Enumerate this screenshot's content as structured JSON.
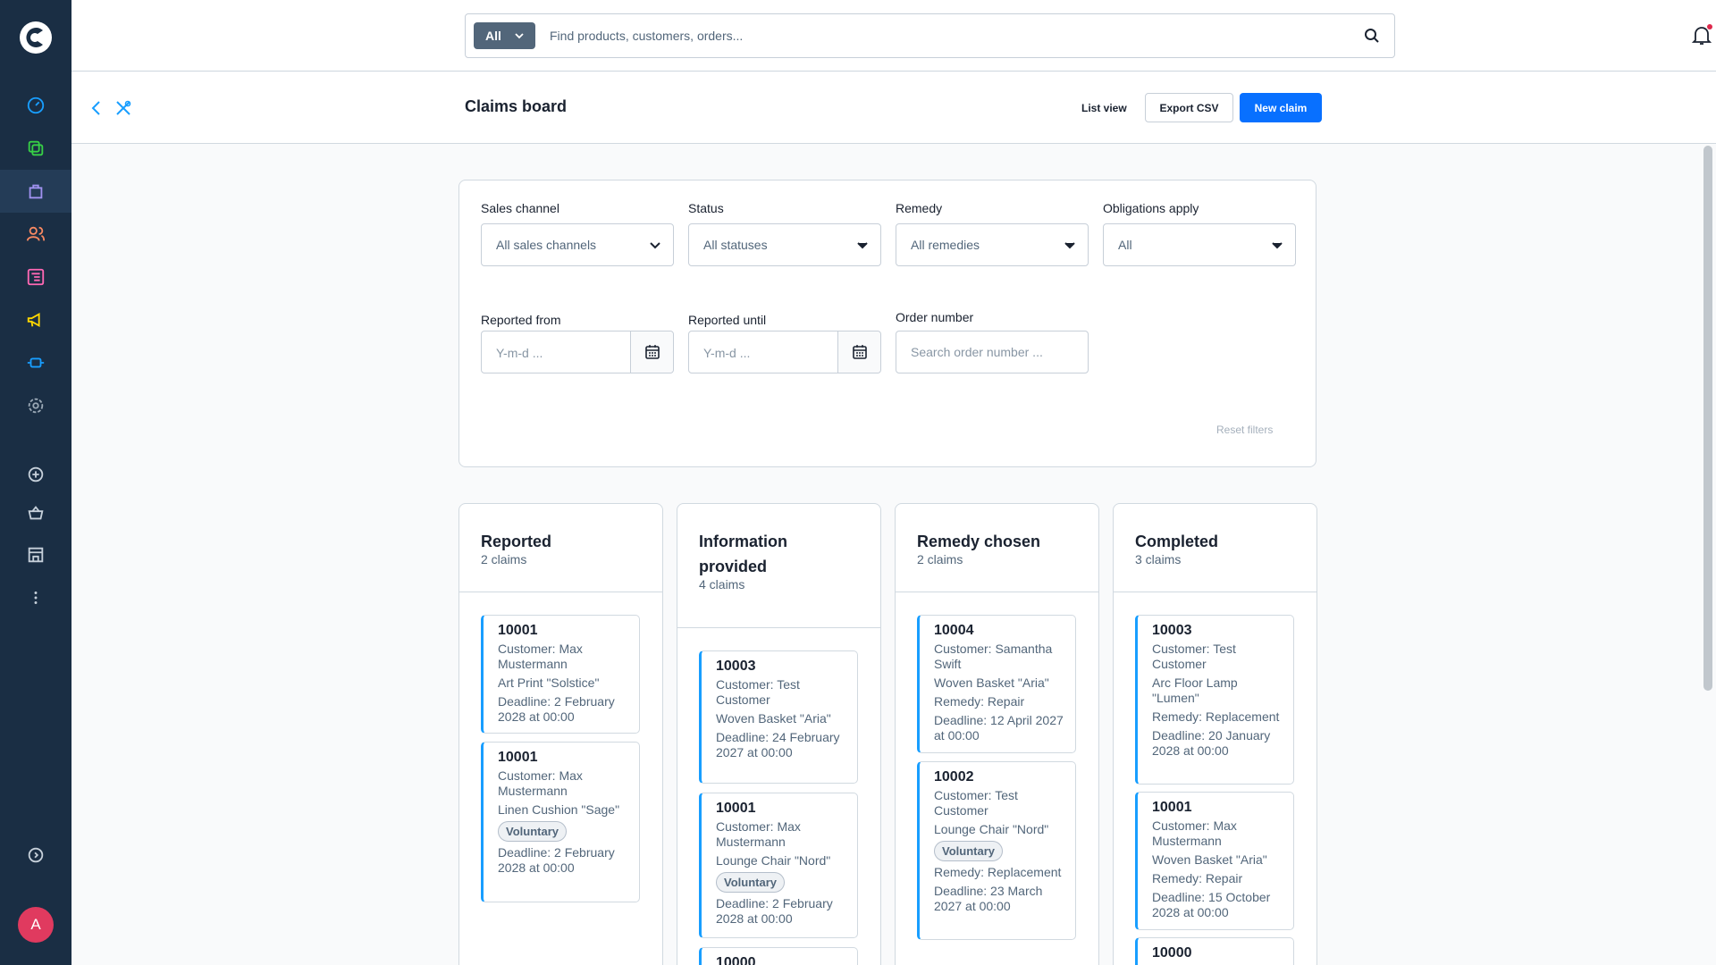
{
  "colors": {
    "sidebar": "#1a2e44",
    "primary": "#0870ff",
    "accent": "#189eff",
    "avatar": "#e03a5f"
  },
  "sidebar": {
    "items": [
      {
        "icon": "dashboard-icon"
      },
      {
        "icon": "catalogues-icon"
      },
      {
        "icon": "orders-icon"
      },
      {
        "icon": "customers-icon"
      },
      {
        "icon": "content-icon"
      },
      {
        "icon": "marketing-icon"
      },
      {
        "icon": "extensions-icon"
      },
      {
        "icon": "settings-icon"
      },
      {
        "icon": "add-circle-icon"
      },
      {
        "icon": "basket-icon"
      },
      {
        "icon": "store-icon"
      },
      {
        "icon": "more-icon"
      },
      {
        "icon": "collapse-icon"
      }
    ],
    "avatar": "A"
  },
  "search": {
    "scope": "All",
    "placeholder": "Find products, customers, orders..."
  },
  "header": {
    "title": "Claims board",
    "list_view": "List view",
    "export_csv": "Export CSV",
    "new_claim": "New claim"
  },
  "filters": {
    "sales_channel": {
      "label": "Sales channel",
      "value": "All sales channels"
    },
    "status": {
      "label": "Status",
      "value": "All statuses"
    },
    "remedy": {
      "label": "Remedy",
      "value": "All remedies"
    },
    "obligations": {
      "label": "Obligations apply",
      "value": "All"
    },
    "reported_from": {
      "label": "Reported from",
      "placeholder": "Y-m-d ..."
    },
    "reported_until": {
      "label": "Reported until",
      "placeholder": "Y-m-d ..."
    },
    "order_number": {
      "label": "Order number",
      "placeholder": "Search order number ..."
    },
    "reset": "Reset filters"
  },
  "columns": [
    {
      "title": "Reported",
      "count": "2 claims",
      "cards": [
        {
          "number": "10001",
          "lines": [
            "Customer: Max Mustermann",
            "Art Print \"Solstice\"",
            "Deadline: 2 February 2028 at 00:00"
          ]
        },
        {
          "number": "10001",
          "lines": [
            "Customer: Max Mustermann",
            "Linen Cushion \"Sage\""
          ],
          "badge": "Voluntary",
          "after": [
            "Deadline: 2 February 2028 at 00:00"
          ]
        }
      ]
    },
    {
      "title": "Information provided",
      "count": "4 claims",
      "cards": [
        {
          "number": "10003",
          "lines": [
            "Customer: Test Customer",
            "Woven Basket \"Aria\"",
            "Deadline: 24 February 2027 at 00:00"
          ]
        },
        {
          "number": "10001",
          "lines": [
            "Customer: Max Mustermann",
            "Lounge Chair \"Nord\""
          ],
          "badge": "Voluntary",
          "after": [
            "Deadline: 2 February 2028 at 00:00"
          ]
        },
        {
          "number": "10000",
          "lines": []
        }
      ]
    },
    {
      "title": "Remedy chosen",
      "count": "2 claims",
      "cards": [
        {
          "number": "10004",
          "lines": [
            "Customer: Samantha Swift",
            "Woven Basket \"Aria\"",
            "Remedy: Repair",
            "Deadline: 12 April 2027 at 00:00"
          ]
        },
        {
          "number": "10002",
          "lines": [
            "Customer: Test Customer",
            "Lounge Chair \"Nord\""
          ],
          "badge": "Voluntary",
          "after": [
            "Remedy: Replacement",
            "Deadline: 23 March 2027 at 00:00"
          ]
        }
      ]
    },
    {
      "title": "Completed",
      "count": "3 claims",
      "cards": [
        {
          "number": "10003",
          "lines": [
            "Customer: Test Customer",
            "Arc Floor Lamp \"Lumen\"",
            "Remedy: Replacement",
            "Deadline: 20 January 2028 at 00:00"
          ]
        },
        {
          "number": "10001",
          "lines": [
            "Customer: Max Mustermann",
            "Woven Basket \"Aria\"",
            "Remedy: Repair",
            "Deadline: 15 October 2028 at 00:00"
          ]
        },
        {
          "number": "10000",
          "lines": []
        }
      ]
    }
  ]
}
